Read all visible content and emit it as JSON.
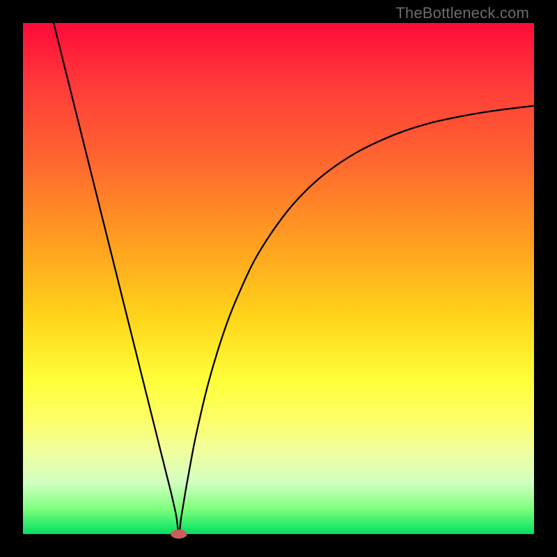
{
  "watermark": "TheBottleneck.com",
  "colors": {
    "page_bg": "#000000",
    "curve_stroke": "#000000",
    "marker_fill": "#cd5c5c",
    "gradient_top": "#ff0a3a",
    "gradient_bottom": "#00e060"
  },
  "chart_data": {
    "type": "line",
    "title": "",
    "xlabel": "",
    "ylabel": "",
    "x_range": [
      0,
      100
    ],
    "y_range": [
      0,
      100
    ],
    "marker": {
      "x": 30.5,
      "y": 0,
      "radius_x": 1.6,
      "radius_y": 0.9
    },
    "series": [
      {
        "name": "bottleneck-curve",
        "x": [
          6,
          8,
          10,
          12,
          14,
          16,
          18,
          20,
          22,
          24,
          26,
          27,
          28,
          29,
          30,
          30.5,
          31,
          32,
          33,
          34,
          36,
          38,
          40,
          42,
          45,
          48,
          52,
          56,
          60,
          65,
          70,
          75,
          80,
          85,
          90,
          95,
          100
        ],
        "y": [
          100,
          92,
          84,
          76,
          68,
          60,
          52,
          44,
          36,
          28,
          20,
          16,
          12,
          8,
          3.5,
          0,
          3.5,
          9.5,
          15,
          20,
          28.5,
          35.5,
          41.5,
          46.5,
          53,
          58,
          63.5,
          67.8,
          71.2,
          74.5,
          77,
          79,
          80.5,
          81.6,
          82.5,
          83.2,
          83.8
        ]
      }
    ]
  }
}
